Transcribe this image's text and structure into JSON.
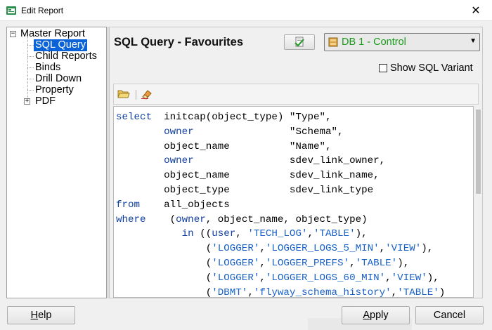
{
  "window": {
    "title": "Edit Report",
    "close_glyph": "✕",
    "app_icon": "report-window-icon"
  },
  "tree": {
    "root_expander": "−",
    "root": "Master Report",
    "items": [
      {
        "label": "SQL Query",
        "selected": true
      },
      {
        "label": "Child Reports",
        "selected": false
      },
      {
        "label": "Binds",
        "selected": false
      },
      {
        "label": "Drill Down",
        "selected": false
      },
      {
        "label": "Property",
        "selected": false
      },
      {
        "label": "PDF",
        "selected": false,
        "expander": "+"
      }
    ]
  },
  "header": {
    "title": "SQL Query - Favourites"
  },
  "connection": {
    "selected": "DB 1 - Control",
    "color": "#1a9a1a"
  },
  "options": {
    "show_sql_variant_label": "Show SQL Variant",
    "show_sql_variant_checked": false
  },
  "toolbar": {
    "open_icon": "folder-open-icon",
    "clear_icon": "eraser-icon"
  },
  "sql": {
    "lines": [
      "select  initcap(object_type) \"Type\",",
      "        owner                \"Schema\",",
      "        object_name          \"Name\",",
      "        owner                sdev_link_owner,",
      "        object_name          sdev_link_name,",
      "        object_type          sdev_link_type",
      "from    all_objects",
      "where    (owner, object_name, object_type)",
      "           in ((user, 'TECH_LOG','TABLE'),",
      "               ('LOGGER','LOGGER_LOGS_5_MIN','VIEW'),",
      "               ('LOGGER','LOGGER_PREFS','TABLE'),",
      "               ('LOGGER','LOGGER_LOGS_60_MIN','VIEW'),",
      "               ('DBMT','flyway_schema_history','TABLE')"
    ],
    "keyword_color": "#0f3da0",
    "string_color": "#1860c8"
  },
  "buttons": {
    "help_mnemonic": "H",
    "help_rest": "elp",
    "apply_mnemonic": "A",
    "apply_rest": "pply",
    "cancel": "Cancel"
  }
}
